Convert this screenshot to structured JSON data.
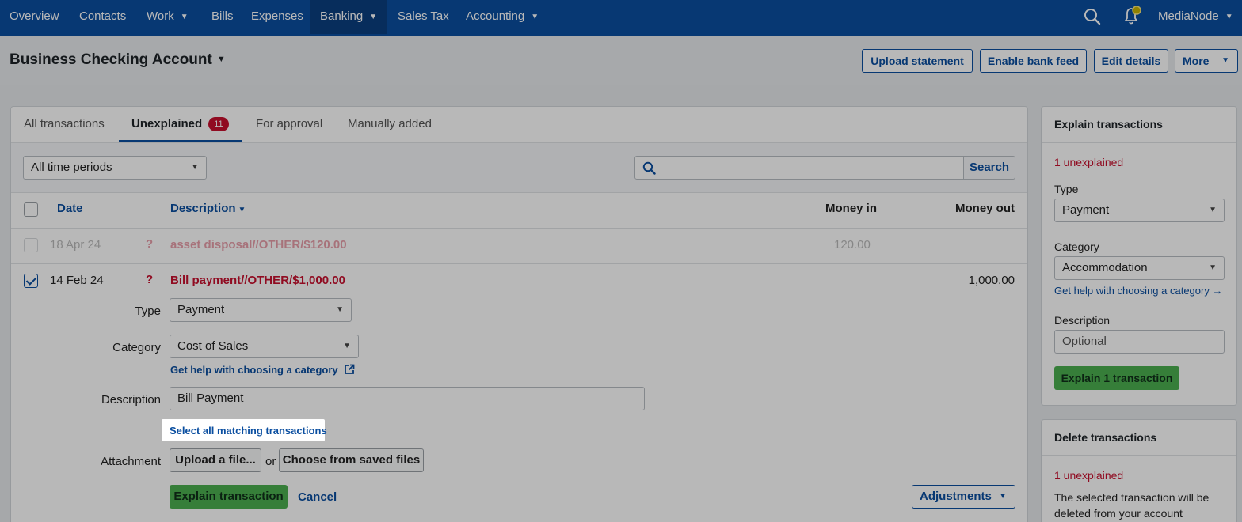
{
  "nav": {
    "items": [
      {
        "label": "Overview"
      },
      {
        "label": "Contacts"
      },
      {
        "label": "Work"
      },
      {
        "label": "Bills"
      },
      {
        "label": "Expenses"
      },
      {
        "label": "Banking"
      },
      {
        "label": "Sales Tax"
      },
      {
        "label": "Accounting"
      }
    ],
    "user": "MediaNode",
    "icons": [
      "search-icon",
      "bell-icon",
      "chevron-down-icon"
    ]
  },
  "account": {
    "title": "Business Checking Account",
    "buttons": {
      "upload": "Upload statement",
      "feed": "Enable bank feed",
      "edit": "Edit details",
      "more": "More"
    }
  },
  "tabs": [
    {
      "label": "All transactions"
    },
    {
      "label": "Unexplained",
      "count": "11"
    },
    {
      "label": "For approval"
    },
    {
      "label": "Manually added"
    }
  ],
  "filter": {
    "period": "All time periods",
    "search_button": "Search"
  },
  "table": {
    "headers": {
      "date": "Date",
      "description": "Description",
      "money_in": "Money in",
      "money_out": "Money out"
    },
    "rows": [
      {
        "date": "18 Apr 24",
        "flag": "?",
        "description": "asset disposal//OTHER/$120.00",
        "money_in": "120.00",
        "money_out": ""
      },
      {
        "date": "14 Feb 24",
        "flag": "?",
        "description": "Bill payment//OTHER/$1,000.00",
        "money_in": "",
        "money_out": "1,000.00"
      }
    ]
  },
  "explain_form": {
    "type_label": "Type",
    "type_value": "Payment",
    "category_label": "Category",
    "category_value": "Cost of Sales",
    "help_link": "Get help with choosing a category",
    "description_label": "Description",
    "description_value": "Bill Payment",
    "select_matching": "Select all matching transactions",
    "attachment_label": "Attachment",
    "upload_button": "Upload a file...",
    "or_text": "or",
    "choose_button": "Choose from saved files",
    "explain_button": "Explain transaction",
    "cancel_link": "Cancel",
    "adjustments_button": "Adjustments"
  },
  "sidebar": {
    "explain": {
      "title": "Explain transactions",
      "count_text": "1 unexplained",
      "type_label": "Type",
      "type_value": "Payment",
      "category_label": "Category",
      "category_value": "Accommodation",
      "help_link": "Get help with choosing a category →",
      "description_label": "Description",
      "description_placeholder": "Optional",
      "button": "Explain 1 transaction"
    },
    "delete": {
      "title": "Delete transactions",
      "count_text": "1 unexplained",
      "body": "The selected transaction will be deleted from your account"
    }
  },
  "colors": {
    "brand": "#0a4ea0",
    "alert": "#c8102e",
    "success": "#4caf50"
  }
}
